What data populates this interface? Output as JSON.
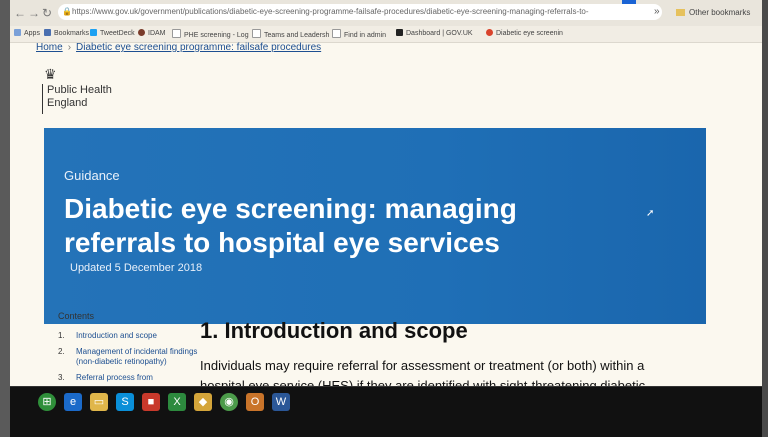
{
  "browser": {
    "url": "https://www.gov.uk/government/publications/diabetic-eye-screening-programme-failsafe-procedures/diabetic-eye-screening-managing-referrals-to-",
    "other_bookmarks": "Other bookmarks",
    "bookmarks": [
      "Apps",
      "Bookmarks",
      "TweetDeck",
      "IDAM",
      "PHE screening - Log",
      "Teams and Leadersh",
      "Find in admin",
      "Dashboard | GOV.UK",
      "Diabetic eye screenin"
    ]
  },
  "breadcrumb": {
    "home": "Home",
    "parent": "Diabetic eye screening programme: failsafe procedures"
  },
  "org": {
    "line1": "Public Health",
    "line2": "England"
  },
  "hero": {
    "kicker": "Guidance",
    "title": "Diabetic eye screening: managing referrals to hospital eye services",
    "updated": "Updated 5 December 2018",
    "color": "#1d70b8"
  },
  "contents": {
    "heading": "Contents",
    "items": [
      {
        "num": "1.",
        "label": "Introduction and scope"
      },
      {
        "num": "2.",
        "label": "Management of incidental findings (non-diabetic retinopathy)"
      },
      {
        "num": "3.",
        "label": "Referral process from"
      }
    ]
  },
  "section": {
    "title": "1. Introduction and scope",
    "body": "Individuals may require referral for assessment or treatment (or both) within a hospital eye service (HES) if they are identified with sight-threatening diabetic retinopathy (STDR) in routine digital screening, digital surveillance or slit lamp"
  }
}
